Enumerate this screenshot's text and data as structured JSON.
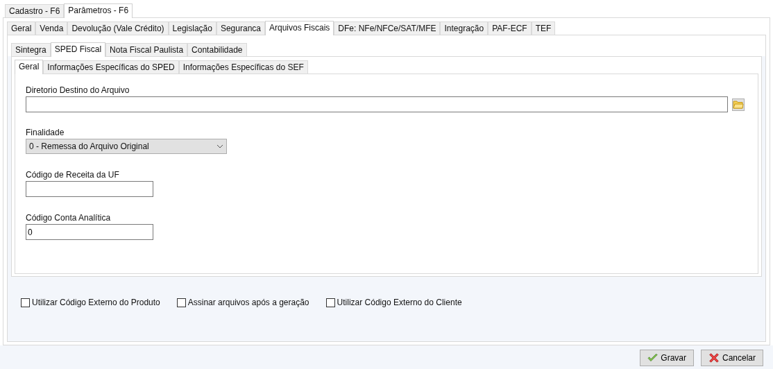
{
  "main_tabs": [
    {
      "label": "Cadastro - F6",
      "selected": false
    },
    {
      "label": "Parâmetros - F6",
      "selected": true
    }
  ],
  "section_tabs": [
    {
      "label": "Geral",
      "selected": false
    },
    {
      "label": "Venda",
      "selected": false
    },
    {
      "label": "Devolução (Vale Crédito)",
      "selected": false
    },
    {
      "label": "Legislação",
      "selected": false
    },
    {
      "label": "Seguranca",
      "selected": false
    },
    {
      "label": "Arquivos Fiscais",
      "selected": true
    },
    {
      "label": "DFe: NFe/NFCe/SAT/MFE",
      "selected": false
    },
    {
      "label": "Integração",
      "selected": false
    },
    {
      "label": "PAF-ECF",
      "selected": false
    },
    {
      "label": "TEF",
      "selected": false
    }
  ],
  "file_tabs": [
    {
      "label": "Sintegra",
      "selected": false
    },
    {
      "label": "SPED Fiscal",
      "selected": true
    },
    {
      "label": "Nota Fiscal Paulista",
      "selected": false
    },
    {
      "label": "Contabilidade",
      "selected": false
    }
  ],
  "sped_tabs": [
    {
      "label": "Geral",
      "selected": true
    },
    {
      "label": "Informações Específicas do SPED",
      "selected": false
    },
    {
      "label": "Informações Específicas do SEF",
      "selected": false
    }
  ],
  "form": {
    "directory": {
      "label": "Diretorio Destino do Arquivo"
    },
    "purpose": {
      "label": "Finalidade",
      "value": "0 - Remessa do Arquivo Original"
    },
    "revenue_code": {
      "label": "Código de Receita da UF"
    },
    "account_code": {
      "label": "Código Conta Analítica",
      "value": "0"
    }
  },
  "options": [
    {
      "label": "Utilizar Código Externo do Produto",
      "checked": false
    },
    {
      "label": "Assinar arquivos após a geração",
      "checked": false
    },
    {
      "label": "Utilizar Código Externo do Cliente",
      "checked": false
    }
  ],
  "buttons": [
    {
      "kind": "save",
      "label": "Gravar"
    },
    {
      "kind": "cancel",
      "label": "Cancelar"
    }
  ]
}
